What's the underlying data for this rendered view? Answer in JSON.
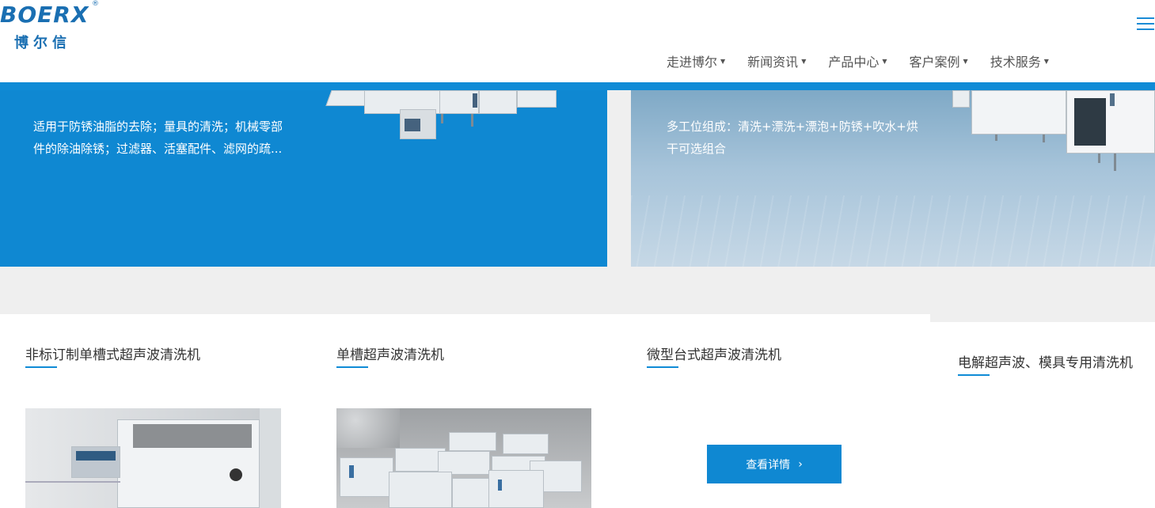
{
  "brand": {
    "name_en": "BOERX",
    "registered": "®",
    "name_cn": "博尔信"
  },
  "nav": {
    "items": [
      {
        "label": "走进博尔"
      },
      {
        "label": "新闻资讯"
      },
      {
        "label": "产品中心"
      },
      {
        "label": "客户案例"
      },
      {
        "label": "技术服务"
      }
    ],
    "caret": "▼",
    "menu_icon": "hamburger-menu-icon"
  },
  "panels": {
    "left_text_1": "适用于防锈油脂的去除；量具的清洗；机械零部",
    "left_text_2": "件的除油除锈；过滤器、活塞配件、滤网的疏...",
    "right_text_1": "多工位组成：清洗+漂洗+漂泡+防锈+吹水+烘",
    "right_text_2": "干可选组合"
  },
  "products": [
    {
      "title": "非标订制单槽式超声波清洗机"
    },
    {
      "title": "单槽超声波清洗机"
    },
    {
      "title": "微型台式超声波清洗机"
    },
    {
      "title": "电解超声波、模具专用清洗机"
    }
  ],
  "detail_button": {
    "label": "查看详情",
    "chevron": "›"
  },
  "colors": {
    "accent": "#0f88d2",
    "brand": "#1a6fb2",
    "background": "#efefef"
  }
}
